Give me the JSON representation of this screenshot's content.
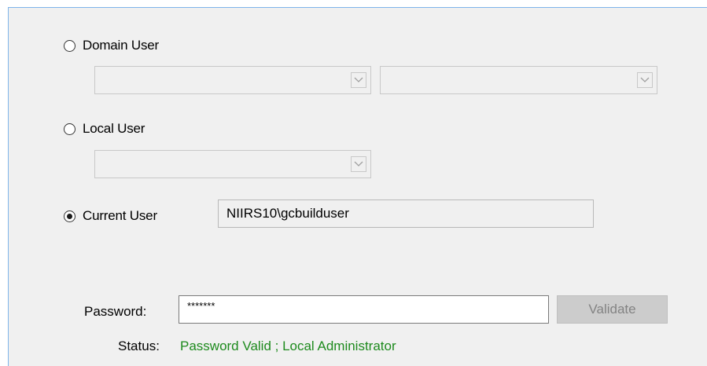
{
  "options": {
    "domain_user_label": "Domain User",
    "local_user_label": "Local User",
    "current_user_label": "Current User",
    "selected": "current_user"
  },
  "current_user": {
    "value": "NIIRS10\\gcbuilduser"
  },
  "password": {
    "label": "Password:",
    "value": "*******"
  },
  "validate_button": {
    "label": "Validate"
  },
  "status": {
    "label": "Status:",
    "value": "Password Valid ; Local Administrator",
    "color": "#1d8a1d"
  },
  "icons": {
    "combo_arrow": "chevron-down-icon"
  }
}
